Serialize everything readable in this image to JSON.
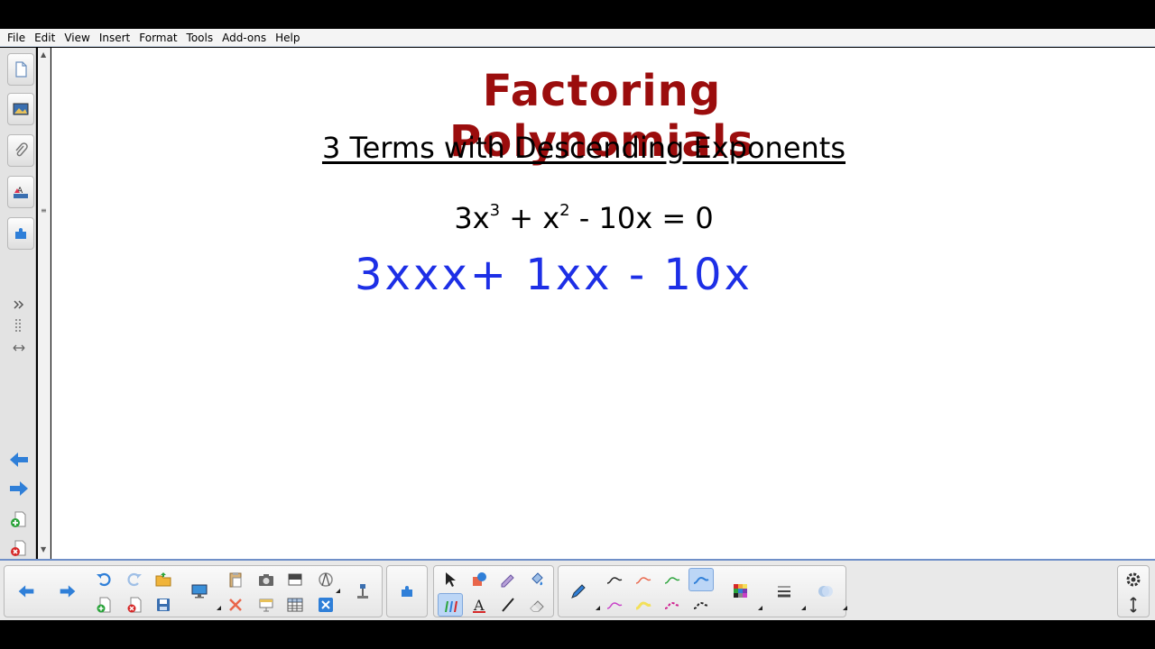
{
  "menu": {
    "items": [
      {
        "label": "File"
      },
      {
        "label": "Edit"
      },
      {
        "label": "View"
      },
      {
        "label": "Insert"
      },
      {
        "label": "Format"
      },
      {
        "label": "Tools"
      },
      {
        "label": "Add-ons"
      },
      {
        "label": "Help"
      }
    ]
  },
  "canvas": {
    "title": "Factoring Polynomials",
    "subtitle": "3 Terms with Descending Exponents",
    "equation": {
      "t1": "3x",
      "e1": "3",
      "op1": " + x",
      "e2": "2",
      "rest": " - 10x = 0"
    },
    "handwriting": "3xxx+ 1xx - 10x",
    "handwriting_color": "#1d2fe6",
    "title_color": "#9b0d0d"
  },
  "side_icons": [
    "page-sorter-icon",
    "gallery-icon",
    "attachments-icon",
    "properties-icon",
    "addons-icon",
    "expand-icon",
    "resize-grip-icon",
    "move-sidebar-icon",
    "previous-page-icon",
    "next-page-icon",
    "add-page-icon",
    "delete-page-icon"
  ],
  "colors": {
    "accent": "#2f7fd8",
    "toolbar_border": "#6f8fc8"
  }
}
